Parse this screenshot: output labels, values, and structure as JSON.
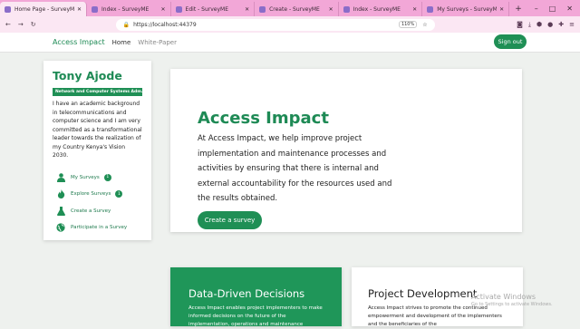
{
  "browser": {
    "tabs": [
      {
        "title": "Home Page - SurveyME"
      },
      {
        "title": "Index - SurveyME"
      },
      {
        "title": "Edit - SurveyME"
      },
      {
        "title": "Create - SurveyME"
      },
      {
        "title": "Index - SurveyME"
      },
      {
        "title": "My Surveys - SurveyME"
      }
    ],
    "url": "https://localhost:44379",
    "zoom": "110%"
  },
  "navbar": {
    "brand": "Access Impact",
    "links": [
      "Home",
      "White-Paper"
    ],
    "signout": "Sign out"
  },
  "profile": {
    "name": "Tony Ajode",
    "badge": "Network and Computer Systems Adm...",
    "bio": "I have an academic background in telecommunications and computer science and I am very committed as a transformational leader towards the realization of my Country Kenya's Vision 2030.",
    "menu": [
      {
        "label": "My Surveys",
        "count": "1",
        "icon": "person-icon"
      },
      {
        "label": "Explore Surveys",
        "count": "1",
        "icon": "flame-icon"
      },
      {
        "label": "Create a Survey",
        "icon": "flask-icon"
      },
      {
        "label": "Participate in a Survey",
        "icon": "globe-icon"
      }
    ]
  },
  "hero": {
    "title": "Access Impact",
    "text": "At Access Impact, we help improve project implementation and maintenance processes and activities by ensuring that there is internal and external accountability for the resources used and the results obtained.",
    "button": "Create a survey"
  },
  "features": [
    {
      "title": "Data-Driven Decisions",
      "text": "Access Impact enables project implementers to make informed decisions on the future of the implementation, operations and maintenance"
    },
    {
      "title": "Project Development",
      "text": "Access Impact strives to promote the continued empowerment and development of the implementers and the beneficiaries of the"
    }
  ],
  "watermark": {
    "title": "Activate Windows",
    "subtitle": "Go to Settings to activate Windows."
  },
  "colors": {
    "brand": "#1f8f55",
    "tabbar": "#f2a7d7"
  }
}
